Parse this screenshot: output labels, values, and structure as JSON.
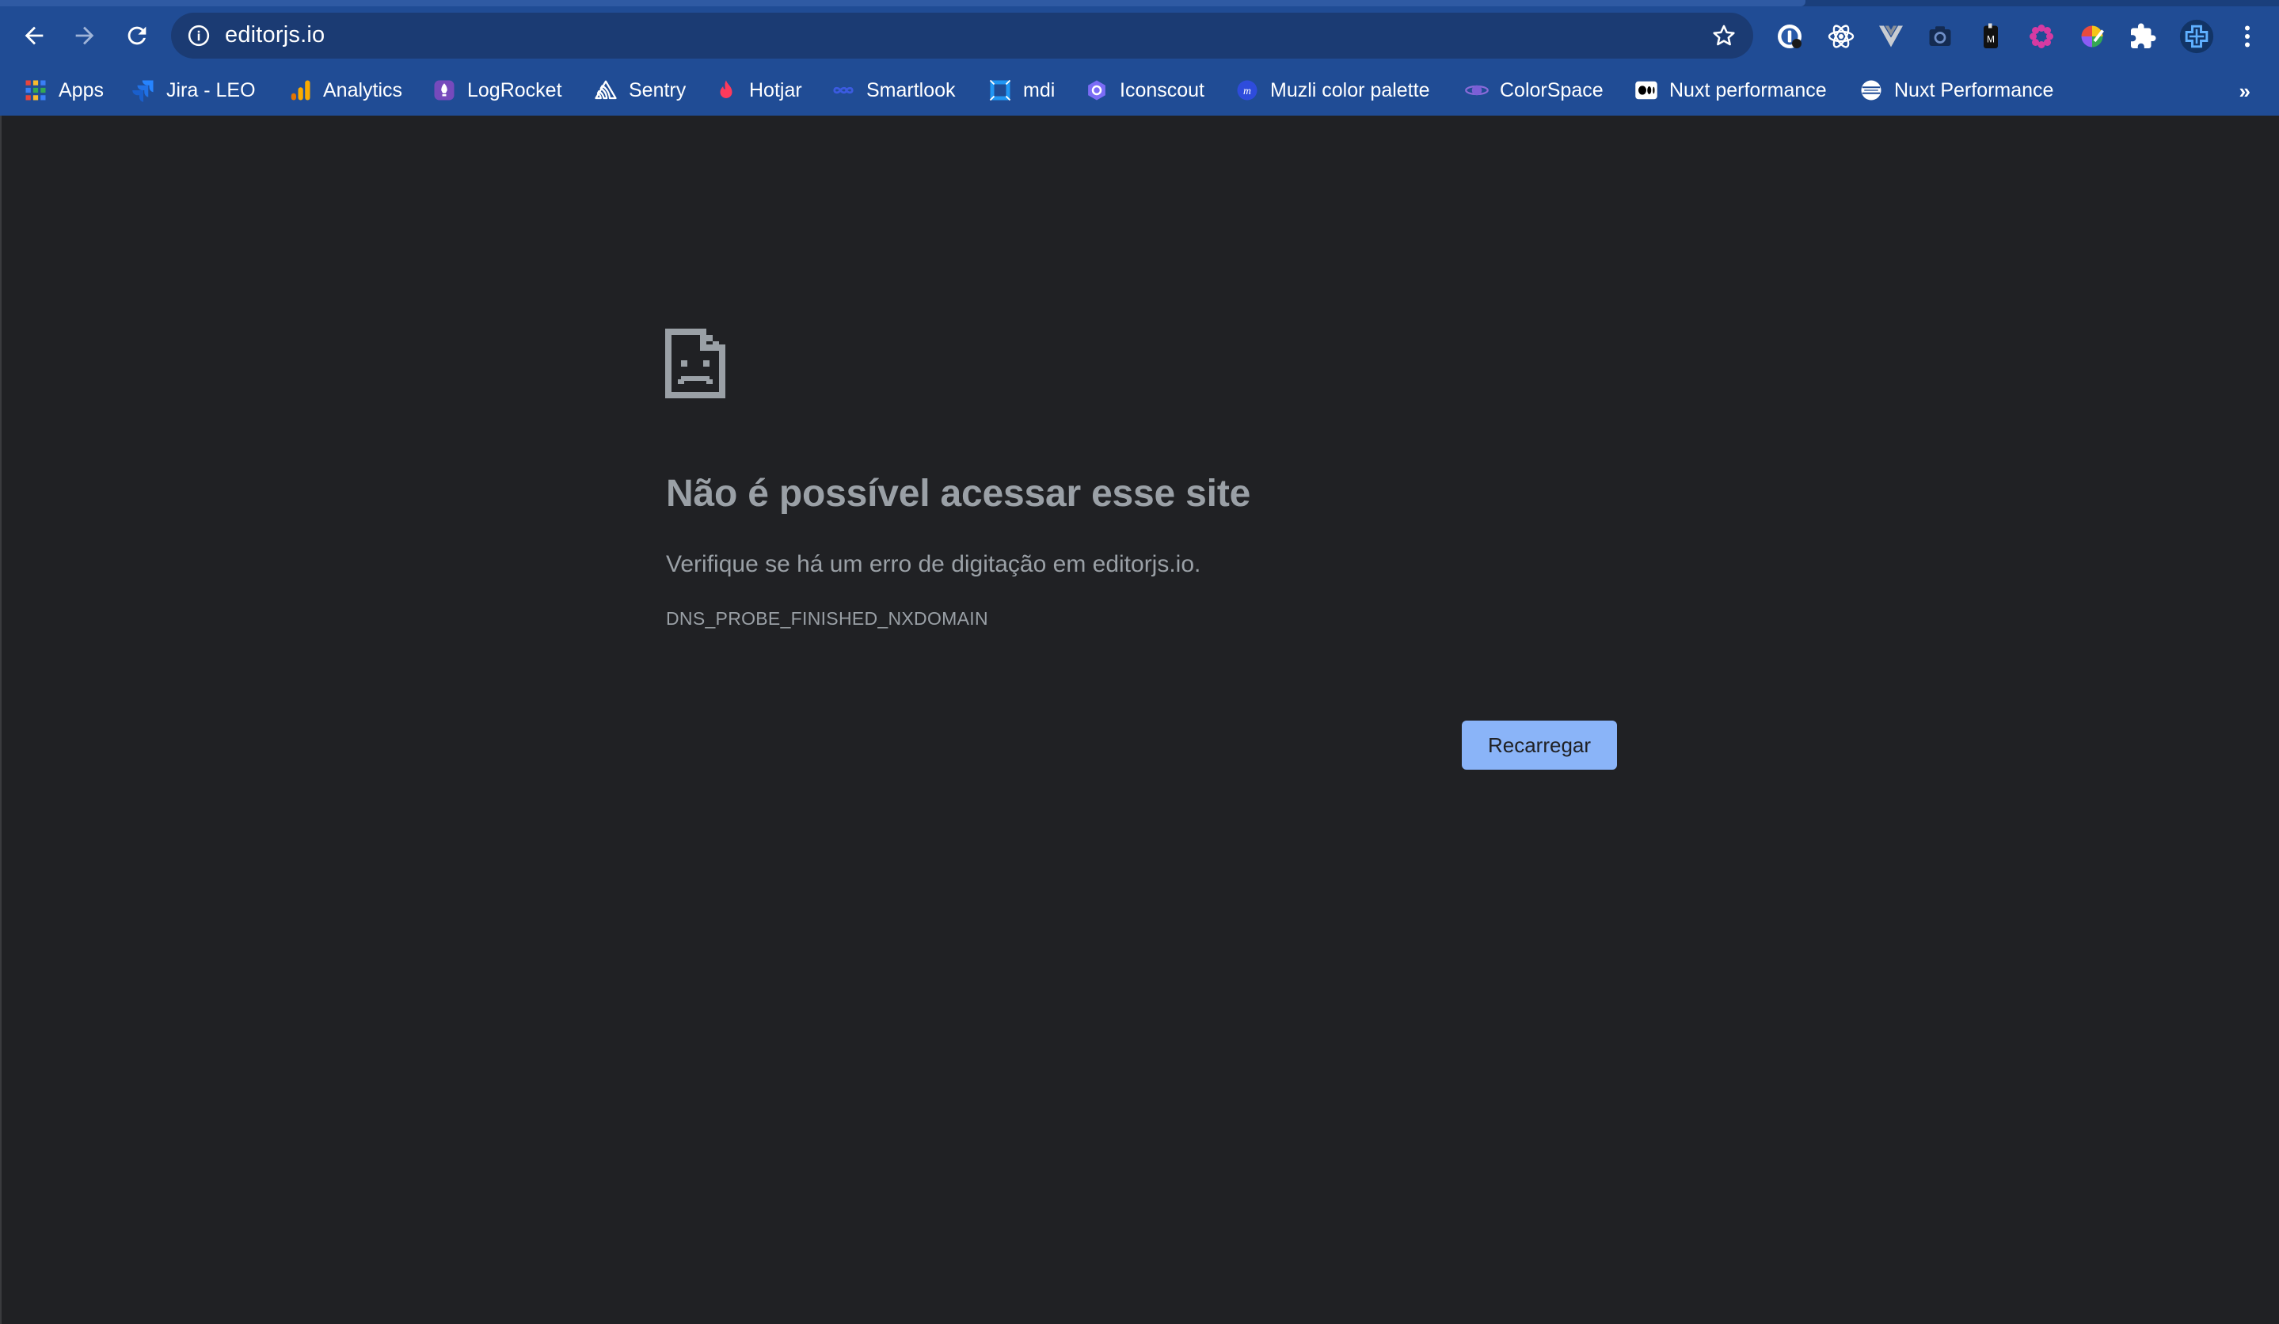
{
  "browser": {
    "url": "editorjs.io",
    "nav": {
      "back": "back-arrow",
      "forward": "forward-arrow",
      "reload": "reload"
    },
    "extensions": [
      "1password-icon",
      "react-devtools-icon",
      "vue-icon",
      "screenshot-icon",
      "mobile-icon",
      "settings-flower-icon",
      "color-picker-icon",
      "puzzle-icon",
      "profile-icon",
      "kebab-menu-icon"
    ]
  },
  "bookmarks": {
    "items": [
      {
        "label": "Apps",
        "icon": "apps-grid-icon"
      },
      {
        "label": "Jira - LEO",
        "icon": "jira-icon"
      },
      {
        "label": "Analytics",
        "icon": "analytics-icon"
      },
      {
        "label": "LogRocket",
        "icon": "logrocket-icon"
      },
      {
        "label": "Sentry",
        "icon": "sentry-icon"
      },
      {
        "label": "Hotjar",
        "icon": "hotjar-icon"
      },
      {
        "label": "Smartlook",
        "icon": "smartlook-icon"
      },
      {
        "label": "mdi",
        "icon": "mdi-icon"
      },
      {
        "label": "Iconscout",
        "icon": "iconscout-icon"
      },
      {
        "label": "Muzli color palette",
        "icon": "muzli-icon"
      },
      {
        "label": "ColorSpace",
        "icon": "colorspace-icon"
      },
      {
        "label": "Nuxt performance",
        "icon": "medium-icon"
      },
      {
        "label": "Nuxt Performance",
        "icon": "globe-icon"
      }
    ],
    "overflow": "»"
  },
  "error": {
    "title": "Não é possível acessar esse site",
    "subtitle": "Verifique se há um erro de digitação em editorjs.io.",
    "code": "DNS_PROBE_FINISHED_NXDOMAIN",
    "reload_label": "Recarregar"
  },
  "colors": {
    "chrome": "#204c95",
    "omnibox": "#1b3b73",
    "page_bg": "#202124",
    "text_muted": "#9aa0a6",
    "button": "#8ab4f8"
  }
}
